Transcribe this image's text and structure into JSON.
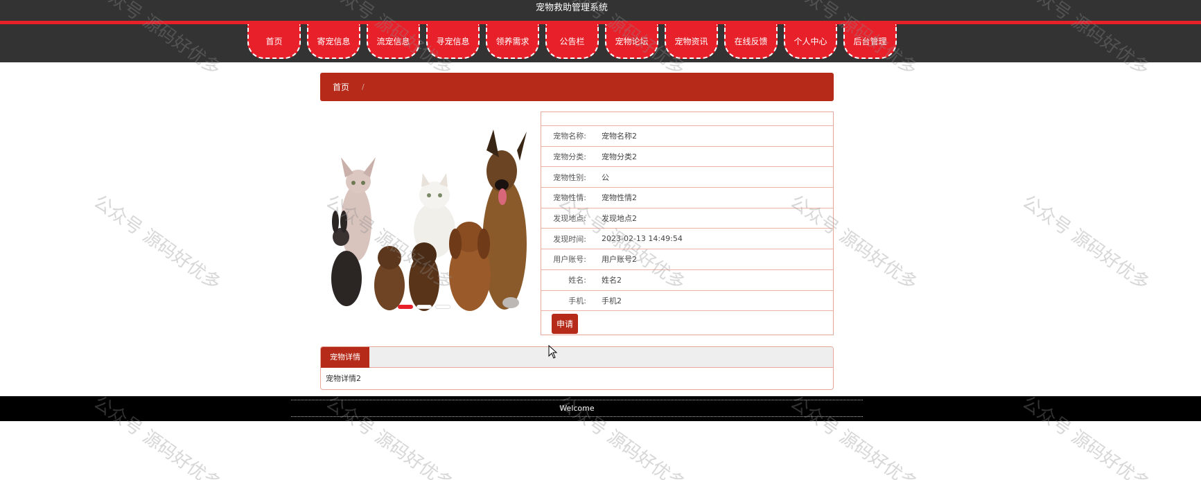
{
  "header": {
    "title": "宠物救助管理系统"
  },
  "nav": [
    "首页",
    "寄宠信息",
    "流宠信息",
    "寻宠信息",
    "领养需求",
    "公告栏",
    "宠物论坛",
    "宠物资讯",
    "在线反馈",
    "个人中心",
    "后台管理"
  ],
  "breadcrumb": {
    "home": "首页",
    "separator": "/"
  },
  "info": {
    "rows": [
      {
        "label": "宠物名称:",
        "value": "宠物名称2"
      },
      {
        "label": "宠物分类:",
        "value": "宠物分类2"
      },
      {
        "label": "宠物性别:",
        "value": "公"
      },
      {
        "label": "宠物性情:",
        "value": "宠物性情2"
      },
      {
        "label": "发现地点:",
        "value": "发现地点2"
      },
      {
        "label": "发现时间:",
        "value": "2023-02-13 14:49:54"
      },
      {
        "label": "用户账号:",
        "value": "用户账号2"
      },
      {
        "label": "姓名:",
        "value": "姓名2"
      },
      {
        "label": "手机:",
        "value": "手机2"
      }
    ],
    "apply_label": "申请"
  },
  "detail": {
    "tab_label": "宠物详情",
    "content": "宠物详情2"
  },
  "footer": {
    "text": "Welcome"
  },
  "watermark": "公众号 源码好优多",
  "colors": {
    "accent": "#e8202a",
    "dark_red": "#b52a18",
    "header_bg": "#333333",
    "footer_bg": "#000000"
  }
}
